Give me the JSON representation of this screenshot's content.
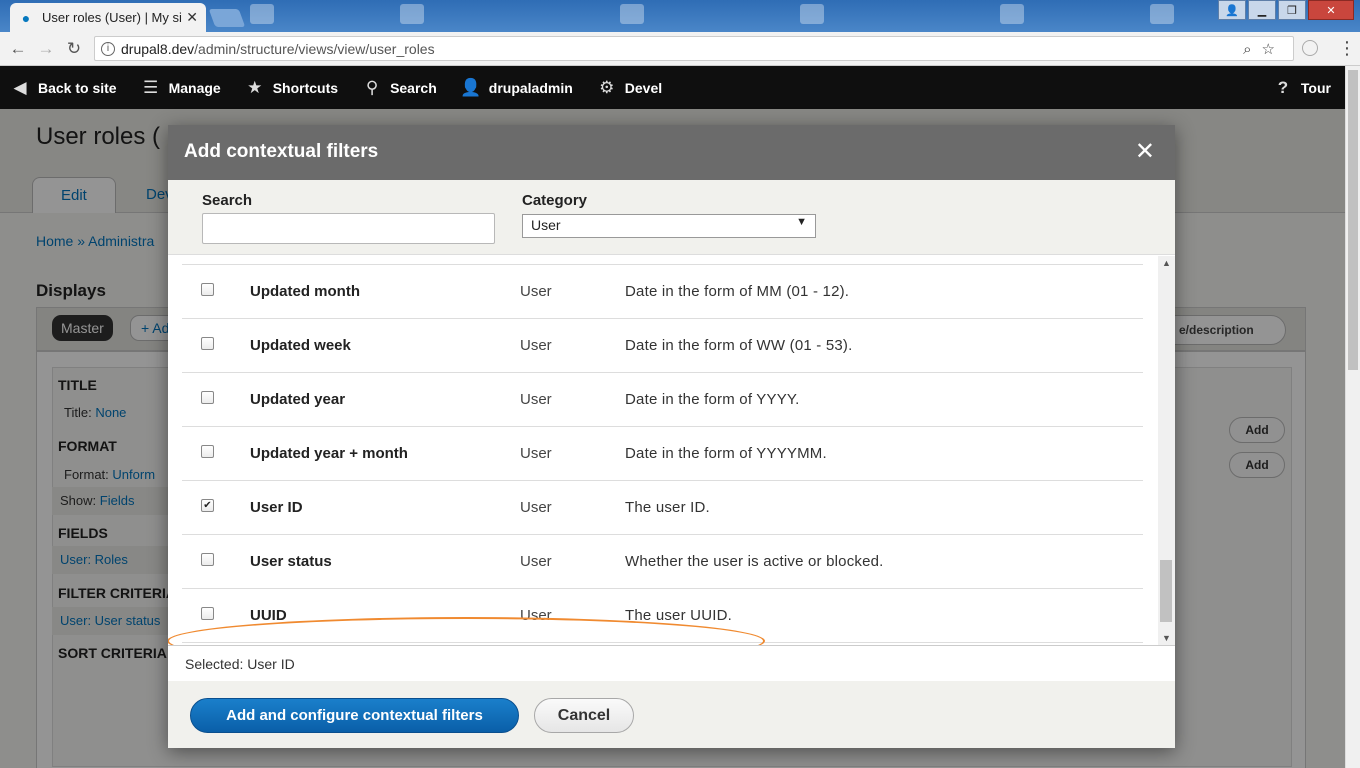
{
  "browser": {
    "tab_title": "User roles (User) | My site",
    "url_host": "drupal8.dev",
    "url_path": "/admin/structure/views/view/user_roles"
  },
  "toolbar": {
    "back": "Back to site",
    "manage": "Manage",
    "shortcuts": "Shortcuts",
    "search": "Search",
    "user": "drupaladmin",
    "devel": "Devel",
    "tour": "Tour"
  },
  "background": {
    "page_title": "User roles (",
    "tab_edit": "Edit",
    "tab_dev": "Dev",
    "breadcrumb": "Home » Administra",
    "displays": "Displays",
    "master": "Master",
    "add_display": "+ Ad",
    "right_button": "e/description",
    "title_h": "TITLE",
    "title_line_label": "Title:",
    "title_line_value": "None",
    "format_h": "FORMAT",
    "format_line_label": "Format:",
    "format_line_value": "Unform",
    "show_line_label": "Show:",
    "show_line_value": "Fields",
    "fields_h": "FIELDS",
    "fields_chip": "User: Roles",
    "filter_h": "FILTER CRITERIA",
    "filter_chip": "User: User status",
    "sort_h": "SORT CRITERIA",
    "add1": "Add",
    "add2": "Add"
  },
  "modal": {
    "title": "Add contextual filters",
    "search_label": "Search",
    "search_value": "",
    "category_label": "Category",
    "category_value": "User",
    "rows": [
      {
        "name": "Updated month",
        "category": "User",
        "description": "Date in the form of MM (01 - 12).",
        "checked": false
      },
      {
        "name": "Updated week",
        "category": "User",
        "description": "Date in the form of WW (01 - 53).",
        "checked": false
      },
      {
        "name": "Updated year",
        "category": "User",
        "description": "Date in the form of YYYY.",
        "checked": false
      },
      {
        "name": "Updated year + month",
        "category": "User",
        "description": "Date in the form of YYYYMM.",
        "checked": false
      },
      {
        "name": "User ID",
        "category": "User",
        "description": "The user ID.",
        "checked": true
      },
      {
        "name": "User status",
        "category": "User",
        "description": "Whether the user is active or blocked.",
        "checked": false
      },
      {
        "name": "UUID",
        "category": "User",
        "description": "The user UUID.",
        "checked": false
      }
    ],
    "selected_text": "Selected: User ID",
    "primary_button": "Add and configure contextual filters",
    "cancel_button": "Cancel"
  },
  "colors": {
    "highlight": "#f08a30",
    "primary": "#0a6ebd",
    "toolbar": "#0f0f0f"
  }
}
